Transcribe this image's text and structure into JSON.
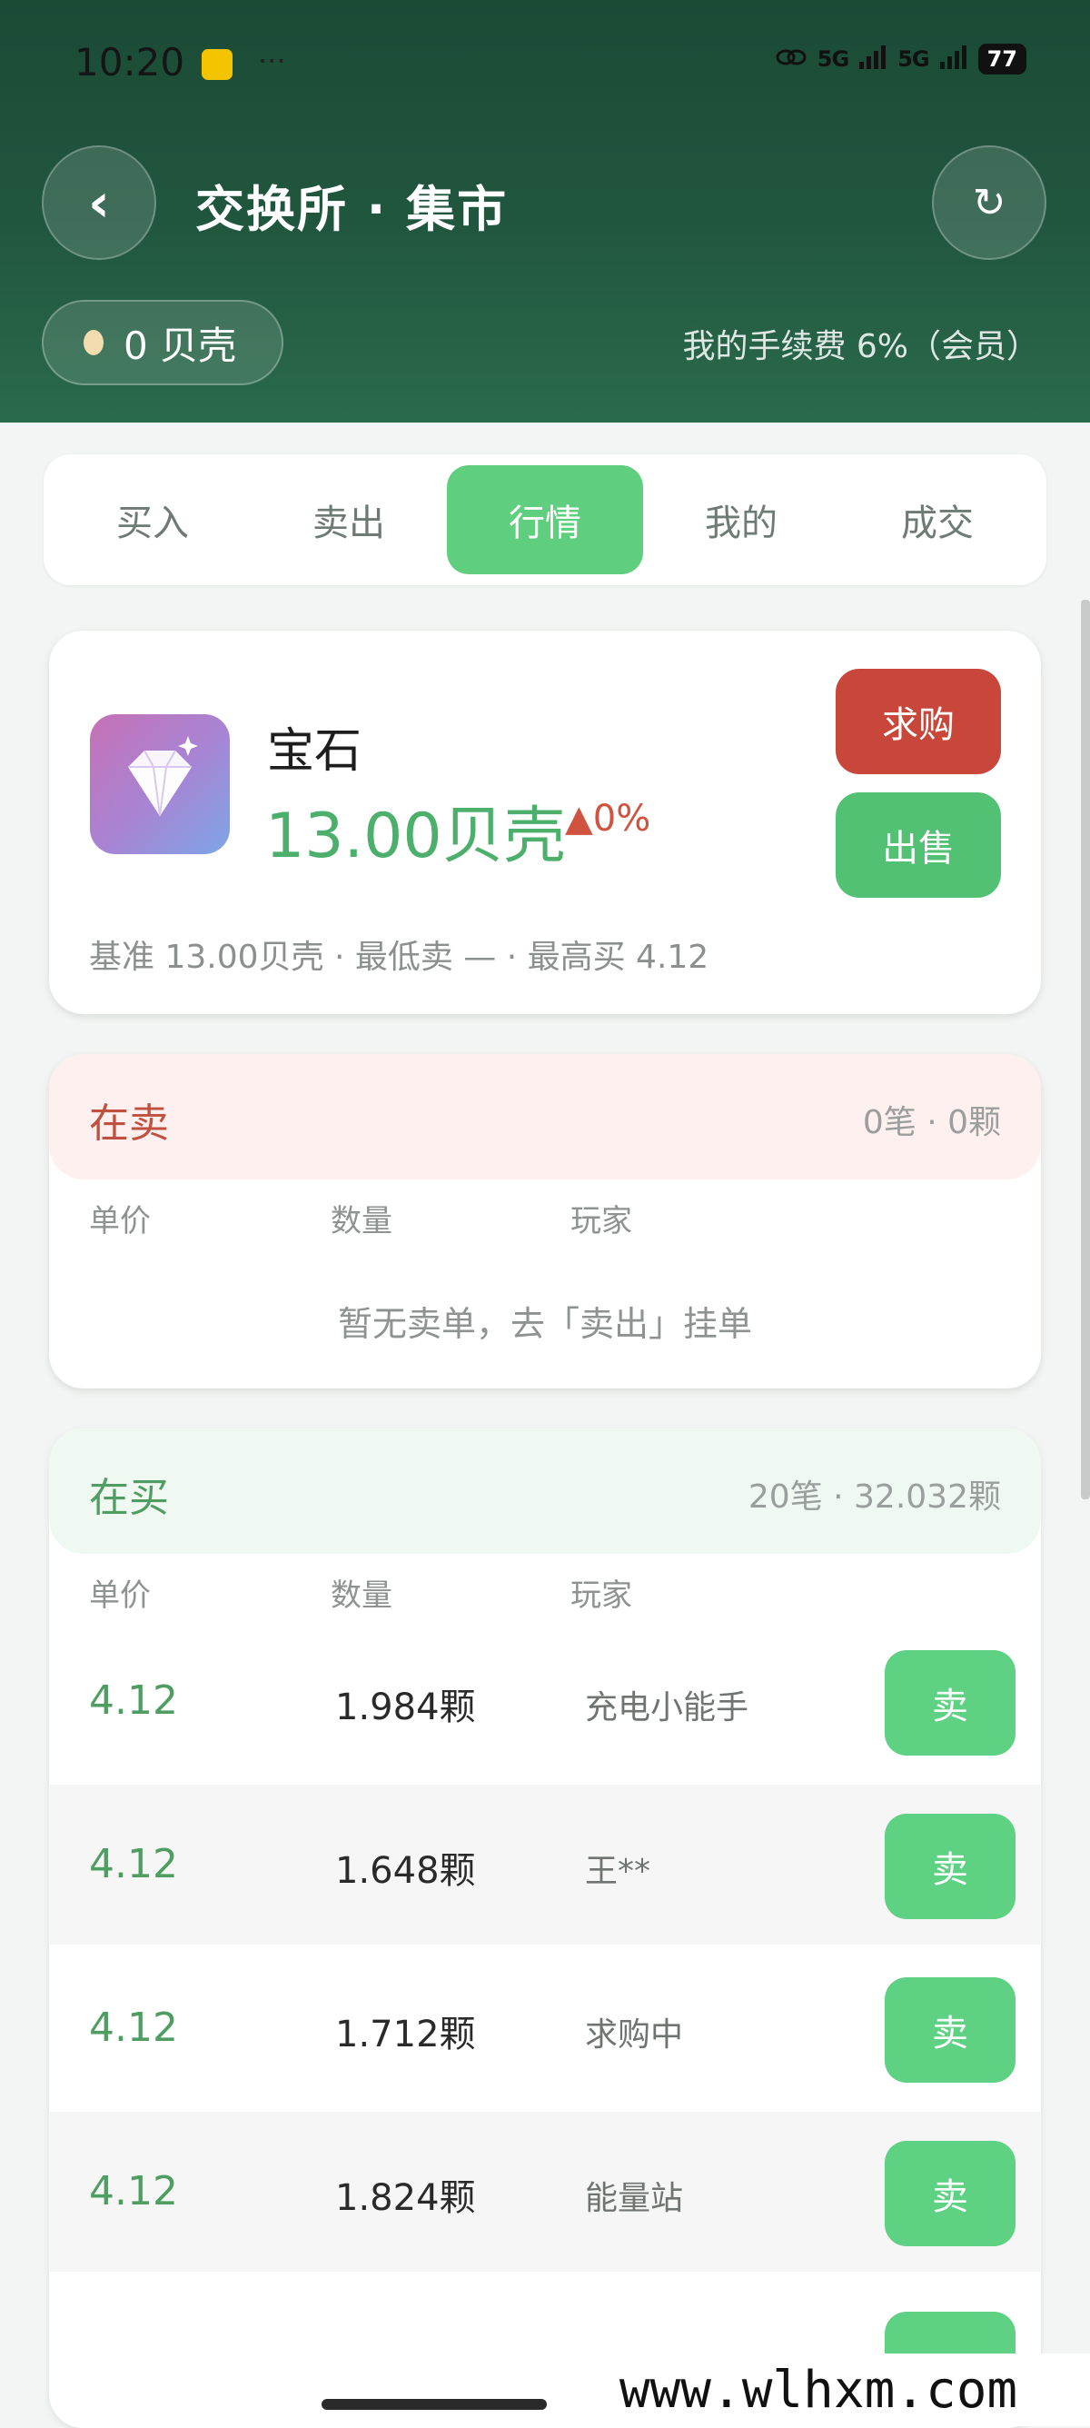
{
  "status_bar": {
    "time": "10:20",
    "dots": "···",
    "signal1": "5G",
    "signal2": "5G",
    "battery": "77"
  },
  "header": {
    "title": "交换所 · 集市",
    "back_symbol": "‹",
    "refresh_symbol": "↻",
    "balance": "0 贝壳",
    "fee": "我的手续费 6%（会员）"
  },
  "tabs": [
    {
      "label": "买入",
      "active": false
    },
    {
      "label": "卖出",
      "active": false
    },
    {
      "label": "行情",
      "active": true
    },
    {
      "label": "我的",
      "active": false
    },
    {
      "label": "成交",
      "active": false
    }
  ],
  "item": {
    "icon": "diamond-icon",
    "name": "宝石",
    "price": "13.00贝壳",
    "change": "▲0%",
    "buy_label": "求购",
    "sell_label": "出售",
    "meta": "基准 13.00贝壳 · 最低卖 — · 最高买 4.12"
  },
  "selling": {
    "title": "在卖",
    "stats": "0笔 · 0颗",
    "col_price": "单价",
    "col_qty": "数量",
    "col_player": "玩家",
    "empty": "暂无卖单，去「卖出」挂单"
  },
  "buying": {
    "title": "在买",
    "stats": "20笔 · 32.032颗",
    "col_price": "单价",
    "col_qty": "数量",
    "col_player": "玩家",
    "rows": [
      {
        "price": "4.12",
        "qty": "1.984颗",
        "player": "充电小能手",
        "action": "卖"
      },
      {
        "price": "4.12",
        "qty": "1.648颗",
        "player": "王**",
        "action": "卖"
      },
      {
        "price": "4.12",
        "qty": "1.712颗",
        "player": "求购中",
        "action": "卖"
      },
      {
        "price": "4.12",
        "qty": "1.824颗",
        "player": "能量站",
        "action": "卖"
      }
    ]
  },
  "watermark": "www.wlhxm.com",
  "colors": {
    "header_bg": "#21573f",
    "accent_green": "#5fcf7f",
    "price_green": "#4daf6c",
    "buy_red": "#c9473a"
  }
}
